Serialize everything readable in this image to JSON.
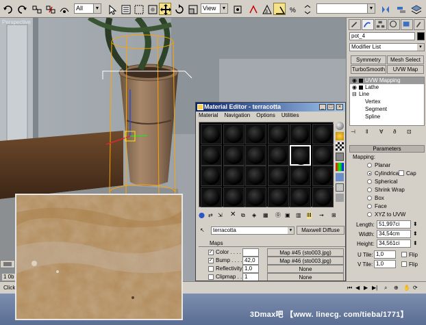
{
  "toolbar": {
    "selection_filter": "All",
    "ref_coord": "View"
  },
  "viewport": {
    "label": "Perspective"
  },
  "command_panel": {
    "object_name": "pot_4",
    "modifier_list": "Modifier List",
    "buttons": [
      "Symmetry",
      "Mesh Select",
      "TurboSmooth",
      "UVW Map"
    ],
    "stack": [
      {
        "label": "UVW Mapping",
        "selected": true
      },
      {
        "label": "Lathe",
        "selected": false
      },
      {
        "label": "Line",
        "selected": false
      },
      {
        "label": "Vertex",
        "selected": false
      },
      {
        "label": "Segment",
        "selected": false
      },
      {
        "label": "Spline",
        "selected": false
      }
    ],
    "parameters": {
      "rollout": "Parameters",
      "mapping_label": "Mapping:",
      "options": [
        "Planar",
        "Cylindrical",
        "Spherical",
        "Shrink Wrap",
        "Box",
        "Face",
        "XYZ to UVW"
      ],
      "selected": "Cylindrical",
      "cap_label": "Cap",
      "length_label": "Length:",
      "length": "51,997ci",
      "width_label": "Width:",
      "width": "34,54cm",
      "height_label": "Height:",
      "height": "34,561ci",
      "utile_label": "U Tile:",
      "utile": "1,0",
      "vtile_label": "V Tile:",
      "vtile": "1,0",
      "flip_label": "Flip"
    }
  },
  "material_editor": {
    "title": "Material Editor - terracotta",
    "menu": [
      "Material",
      "Navigation",
      "Options",
      "Utilities"
    ],
    "material_name": "terracotta",
    "material_type": "Maxwell Diffuse",
    "maps": {
      "header": "Maps",
      "rows": [
        {
          "label": "Color . . . . .",
          "checked": true,
          "amount": "",
          "map": "Map #45 (sto003.jpg)"
        },
        {
          "label": "Bump . . . . .",
          "checked": true,
          "amount": "42,0",
          "map": "Map #46 (sto003.jpg)"
        },
        {
          "label": "Reflectivity",
          "checked": false,
          "amount": "1,0",
          "map": "None"
        },
        {
          "label": "Clipmap . . .",
          "checked": false,
          "amount": "1",
          "map": "None"
        }
      ]
    }
  },
  "bottom": {
    "frame_label": "1 0b",
    "click_label": "Click"
  },
  "footer": {
    "text": "3Dmax吧  【www. linecg. com/tieba/1771】"
  },
  "colors": {
    "titlebar": "#0a246a",
    "panel": "#d4d0c8",
    "footer": "#6a7ea2"
  }
}
